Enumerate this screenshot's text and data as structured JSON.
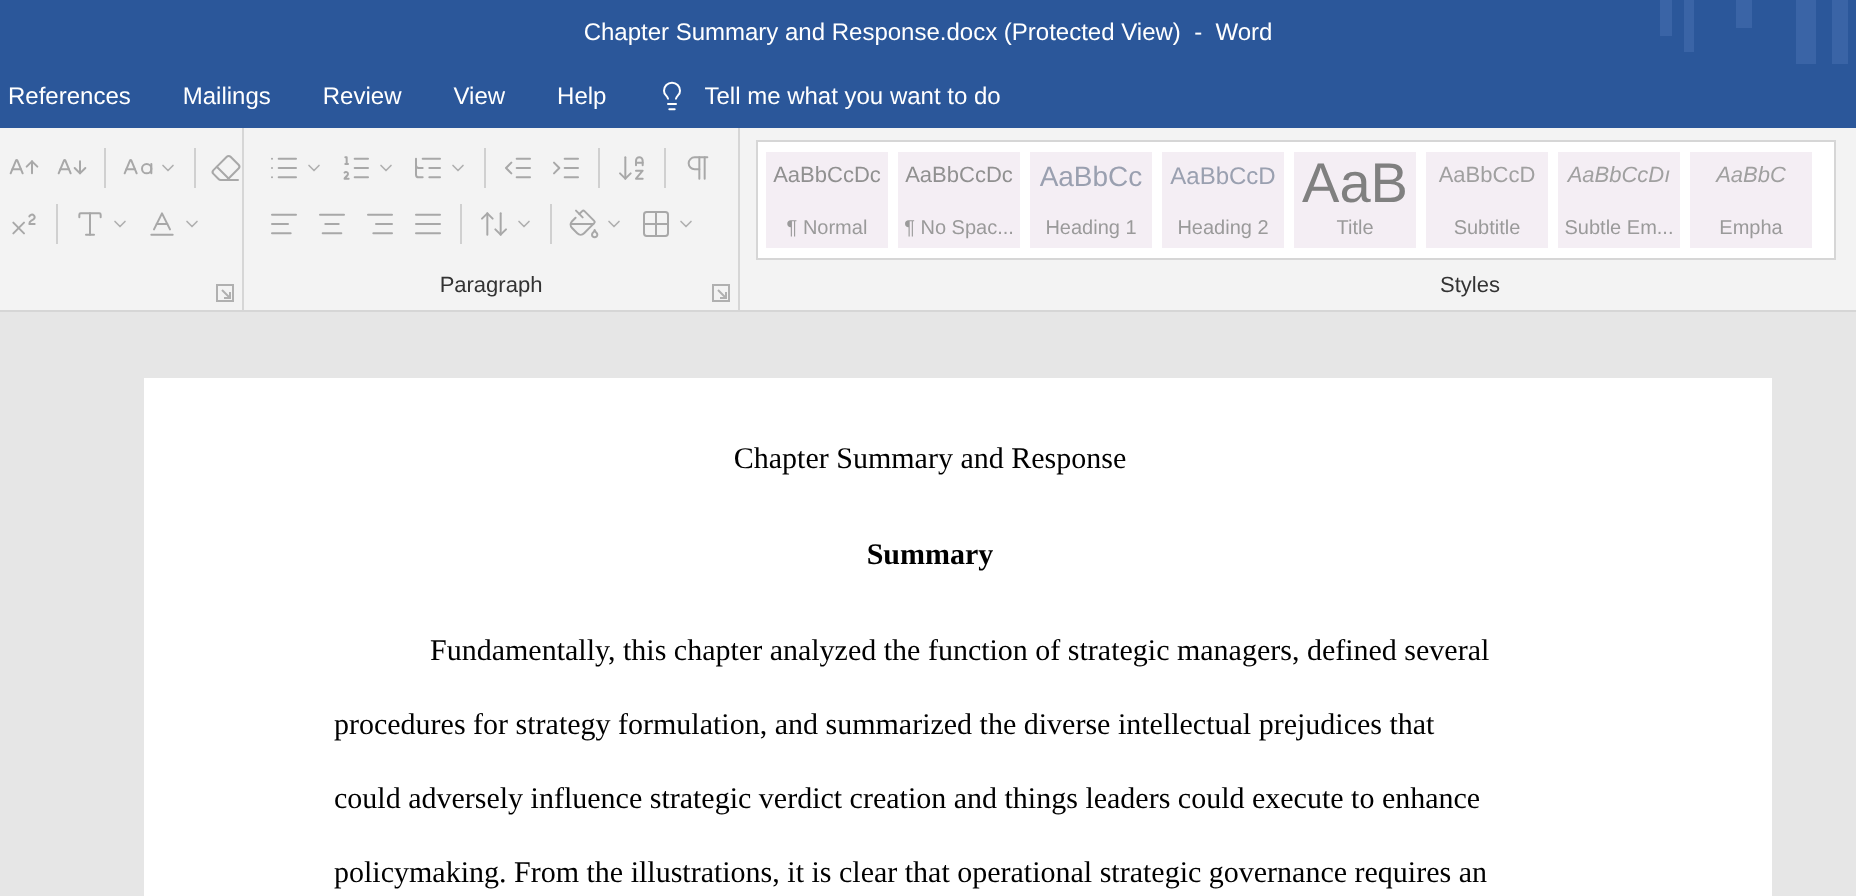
{
  "window": {
    "title": "Chapter Summary and Response.docx (Protected View)  -  Word"
  },
  "menu_tabs": [
    {
      "label": "References"
    },
    {
      "label": "Mailings"
    },
    {
      "label": "Review"
    },
    {
      "label": "View"
    },
    {
      "label": "Help"
    }
  ],
  "tell_me": {
    "placeholder": "Tell me what you want to do"
  },
  "ribbon": {
    "paragraph_group": {
      "label": "Paragraph"
    },
    "styles_group": {
      "label": "Styles",
      "styles": [
        {
          "preview": "AaBbCcDc",
          "label": "¶ Normal",
          "kind": "normal"
        },
        {
          "preview": "AaBbCcDc",
          "label": "¶ No Spac...",
          "kind": "normal"
        },
        {
          "preview": "AaBbCc",
          "label": "Heading 1",
          "kind": "heading1"
        },
        {
          "preview": "AaBbCcD",
          "label": "Heading 2",
          "kind": "heading2"
        },
        {
          "preview": "AaB",
          "label": "Title",
          "kind": "title"
        },
        {
          "preview": "AaBbCcD",
          "label": "Subtitle",
          "kind": "subtitle"
        },
        {
          "preview": "AaBbCcDı",
          "label": "Subtle Em...",
          "kind": "emphasis"
        },
        {
          "preview": "AaBbC",
          "label": "Empha",
          "kind": "emphasis"
        }
      ]
    }
  },
  "document": {
    "title": "Chapter Summary and Response",
    "heading": "Summary",
    "paragraph_lines": [
      "Fundamentally, this chapter analyzed the function of strategic managers, defined several",
      "procedures for strategy formulation, and summarized the diverse intellectual prejudices that",
      "could adversely influence strategic verdict creation and things leaders could execute to enhance",
      "policymaking. From the illustrations, it is clear that operational strategic governance requires an"
    ]
  }
}
